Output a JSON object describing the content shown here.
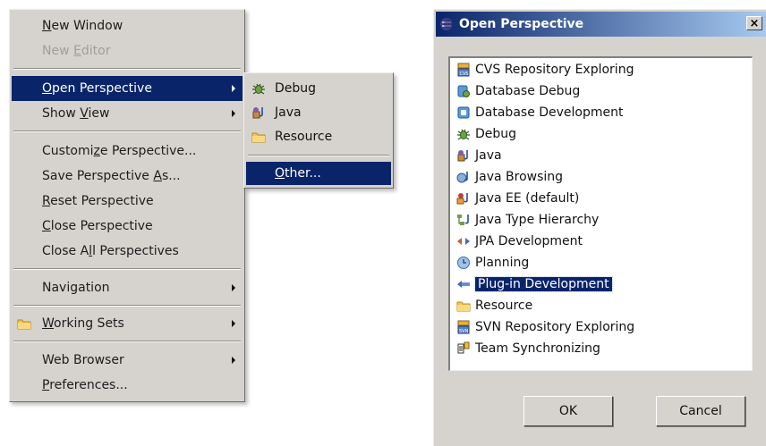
{
  "window_menu": {
    "items": [
      {
        "label": "New Window",
        "mnemonic": "N",
        "enabled": true
      },
      {
        "label": "New Editor",
        "mnemonic": "E",
        "enabled": false
      },
      {
        "label": "Open Perspective",
        "mnemonic": "O",
        "enabled": true,
        "submenu": true,
        "highlighted": true
      },
      {
        "label": "Show View",
        "mnemonic": "V",
        "enabled": true,
        "submenu": true
      },
      {
        "label": "Customize Perspective...",
        "mnemonic": "z",
        "enabled": true
      },
      {
        "label": "Save Perspective As...",
        "mnemonic": "A",
        "enabled": true
      },
      {
        "label": "Reset Perspective",
        "mnemonic": "R",
        "enabled": true
      },
      {
        "label": "Close Perspective",
        "mnemonic": "C",
        "enabled": true
      },
      {
        "label": "Close All Perspectives",
        "mnemonic": "l",
        "enabled": true
      },
      {
        "label": "Navigation",
        "enabled": true,
        "submenu": true
      },
      {
        "label": "Working Sets",
        "mnemonic": "W",
        "enabled": true,
        "submenu": true,
        "icon": "folder-icon"
      },
      {
        "label": "Web Browser",
        "enabled": true,
        "submenu": true
      },
      {
        "label": "Preferences...",
        "mnemonic": "P",
        "enabled": true
      }
    ]
  },
  "open_perspective_submenu": {
    "items": [
      {
        "label": "Debug",
        "icon": "debug-bug-icon"
      },
      {
        "label": "Java",
        "icon": "java-perspective-icon"
      },
      {
        "label": "Resource",
        "icon": "folder-icon"
      },
      {
        "label": "Other...",
        "mnemonic": "O",
        "highlighted": true
      }
    ]
  },
  "dialog": {
    "title": "Open Perspective",
    "close_label": "×",
    "perspectives": [
      {
        "label": "CVS Repository Exploring",
        "icon": "cvs-repository-icon"
      },
      {
        "label": "Database Debug",
        "icon": "database-debug-icon"
      },
      {
        "label": "Database Development",
        "icon": "database-development-icon"
      },
      {
        "label": "Debug",
        "icon": "debug-bug-icon"
      },
      {
        "label": "Java",
        "icon": "java-perspective-icon"
      },
      {
        "label": "Java Browsing",
        "icon": "java-browsing-icon"
      },
      {
        "label": "Java EE (default)",
        "icon": "java-ee-icon"
      },
      {
        "label": "Java Type Hierarchy",
        "icon": "type-hierarchy-icon"
      },
      {
        "label": "JPA Development",
        "icon": "jpa-development-icon"
      },
      {
        "label": "Planning",
        "icon": "planning-clock-icon"
      },
      {
        "label": "Plug-in Development",
        "icon": "plugin-development-icon",
        "selected": true
      },
      {
        "label": "Resource",
        "icon": "folder-icon"
      },
      {
        "label": "SVN Repository Exploring",
        "icon": "svn-repository-icon"
      },
      {
        "label": "Team Synchronizing",
        "icon": "team-synchronizing-icon"
      }
    ],
    "ok_label": "OK",
    "cancel_label": "Cancel"
  },
  "colors": {
    "menu_bg": "#d6d3ce",
    "selection": "#0a246a",
    "title_gradient_start": "#0a246a",
    "title_gradient_end": "#a6caf0",
    "disabled_text": "#a09e99"
  }
}
